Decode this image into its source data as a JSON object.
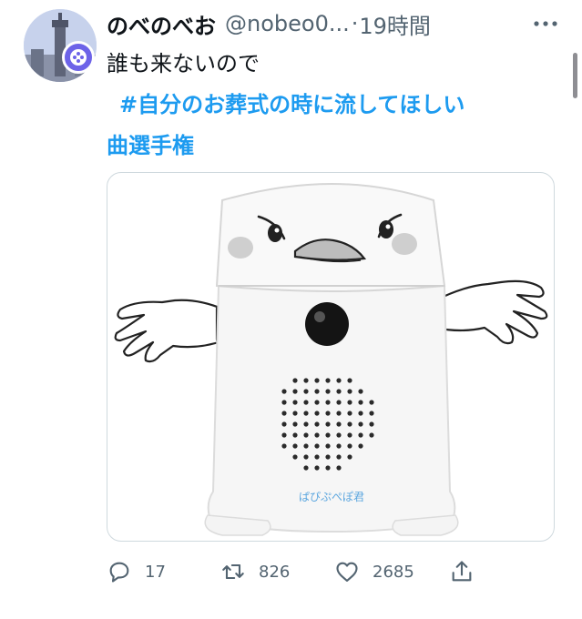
{
  "tweet": {
    "display_name": "のべのべお",
    "handle": "@nobeo0...",
    "separator": "·",
    "time": "19時間",
    "text_line": "誰も来ないので",
    "hashtag_line1": "#自分のお葬式の時に流してほしい",
    "hashtag_line2": "曲選手権"
  },
  "image": {
    "speaker_label": "ぱぴぷぺぽ君"
  },
  "actions": {
    "reply_count": "17",
    "retweet_count": "826",
    "like_count": "2685"
  },
  "icons": {
    "reply": "reply-icon",
    "retweet": "retweet-icon",
    "like": "heart-icon",
    "share": "share-icon",
    "more": "more-options-icon"
  },
  "colors": {
    "accent": "#1d9bf0",
    "text": "#0f1419",
    "secondary": "#536471",
    "badge": "#6d63e8"
  }
}
